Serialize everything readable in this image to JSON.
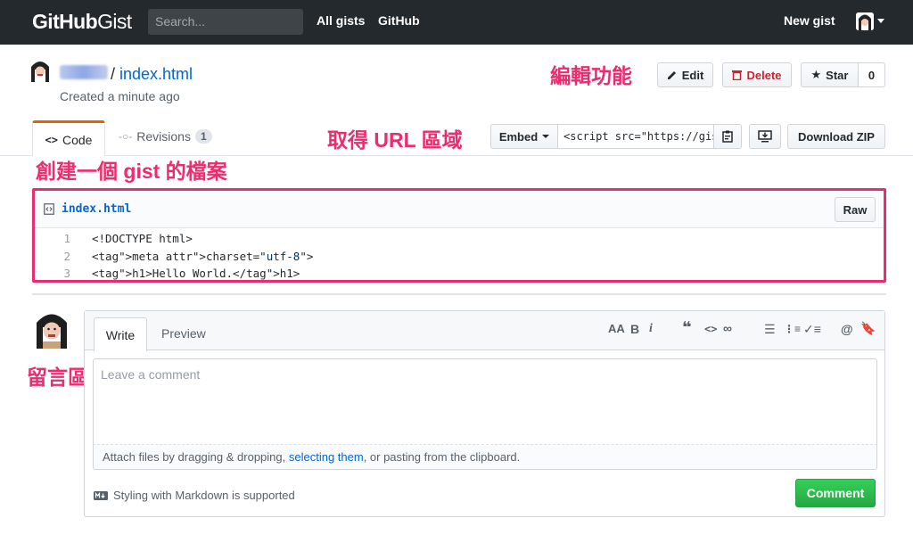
{
  "nav": {
    "logo_bold": "GitHub",
    "logo_light": "Gist",
    "search_placeholder": "Search...",
    "links": [
      "All gists",
      "GitHub"
    ],
    "new_gist": "New gist"
  },
  "gist": {
    "separator": "/",
    "filename": "index.html",
    "created": "Created a minute ago"
  },
  "actions": {
    "edit": "Edit",
    "delete": "Delete",
    "star": "Star",
    "star_count": "0"
  },
  "tabs": {
    "code": "Code",
    "revisions": "Revisions",
    "revisions_count": "1"
  },
  "embed": {
    "label": "Embed",
    "value": "<script src=\"https://gist.github.com/",
    "download": "Download ZIP"
  },
  "annotations": {
    "edit_feature": "編輯功能",
    "url_area": "取得 URL 區域",
    "create_file": "創建一個 gist 的檔案",
    "comment_area": "留言區"
  },
  "file": {
    "name": "index.html",
    "raw": "Raw",
    "lines": [
      {
        "num": "1",
        "text": "<!DOCTYPE html>"
      },
      {
        "num": "2",
        "text": "<meta charset=\"utf-8\">"
      },
      {
        "num": "3",
        "text": "<h1>Hello World.</h1>"
      }
    ]
  },
  "comment": {
    "write": "Write",
    "preview": "Preview",
    "placeholder": "Leave a comment",
    "attach_pre": "Attach files by dragging & dropping, ",
    "attach_link": "selecting them",
    "attach_post": ", or pasting from the clipboard.",
    "markdown_note": "Styling with Markdown is supported",
    "submit": "Comment"
  },
  "colors": {
    "topbar": "#24292e",
    "link": "#0366d6",
    "annotation": "#ea2d6e",
    "success": "#28a745",
    "danger": "#cb2431"
  }
}
